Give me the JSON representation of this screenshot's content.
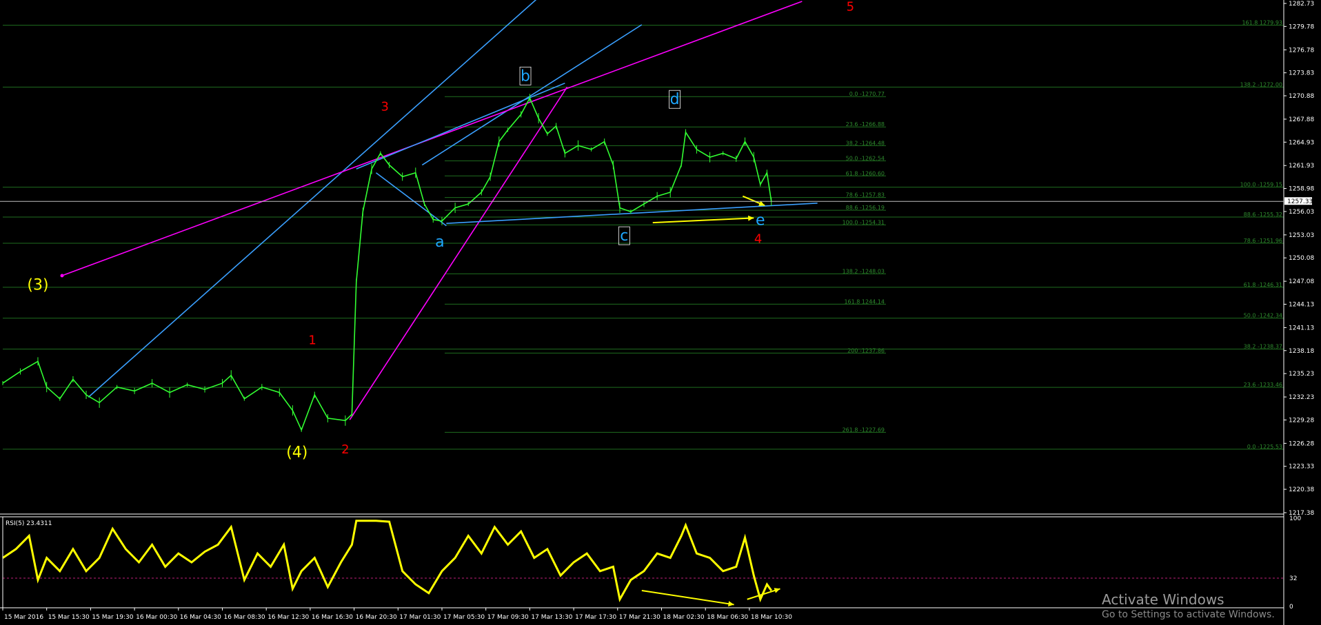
{
  "chart_data": {
    "type": "line",
    "title": "",
    "y_ticks": [
      "1282.73",
      "1279.78",
      "1276.78",
      "1273.83",
      "1270.88",
      "1267.88",
      "1264.93",
      "1261.93",
      "1258.98",
      "1256.03",
      "1253.03",
      "1250.08",
      "1247.08",
      "1244.13",
      "1241.13",
      "1238.18",
      "1235.23",
      "1232.23",
      "1229.28",
      "1226.28",
      "1223.33",
      "1220.38",
      "1217.38"
    ],
    "ylim": [
      1217.38,
      1282.73
    ],
    "x_ticks": [
      "15 Mar 2016",
      "15 Mar 15:30",
      "15 Mar 19:30",
      "16 Mar 00:30",
      "16 Mar 04:30",
      "16 Mar 08:30",
      "16 Mar 12:30",
      "16 Mar 16:30",
      "16 Mar 20:30",
      "17 Mar 01:30",
      "17 Mar 05:30",
      "17 Mar 09:30",
      "17 Mar 13:30",
      "17 Mar 17:30",
      "17 Mar 21:30",
      "18 Mar 02:30",
      "18 Mar 06:30",
      "18 Mar 10:30"
    ],
    "current_price": "1257.33",
    "price_series": [
      {
        "t": 0,
        "y": 1234.0
      },
      {
        "t": 0.4,
        "y": 1235.5
      },
      {
        "t": 0.8,
        "y": 1236.8
      },
      {
        "t": 1.0,
        "y": 1233.5
      },
      {
        "t": 1.3,
        "y": 1232.0
      },
      {
        "t": 1.6,
        "y": 1234.5
      },
      {
        "t": 1.9,
        "y": 1232.5
      },
      {
        "t": 2.2,
        "y": 1231.5
      },
      {
        "t": 2.6,
        "y": 1233.5
      },
      {
        "t": 3.0,
        "y": 1233.0
      },
      {
        "t": 3.4,
        "y": 1234.0
      },
      {
        "t": 3.8,
        "y": 1232.8
      },
      {
        "t": 4.2,
        "y": 1233.8
      },
      {
        "t": 4.6,
        "y": 1233.2
      },
      {
        "t": 5.0,
        "y": 1234.0
      },
      {
        "t": 5.2,
        "y": 1235.0
      },
      {
        "t": 5.5,
        "y": 1232.0
      },
      {
        "t": 5.9,
        "y": 1233.5
      },
      {
        "t": 6.3,
        "y": 1232.8
      },
      {
        "t": 6.6,
        "y": 1230.5
      },
      {
        "t": 6.8,
        "y": 1228.0
      },
      {
        "t": 7.1,
        "y": 1232.5
      },
      {
        "t": 7.4,
        "y": 1229.5
      },
      {
        "t": 7.8,
        "y": 1229.2
      },
      {
        "t": 7.95,
        "y": 1230.0
      },
      {
        "t": 8.05,
        "y": 1247.0
      },
      {
        "t": 8.2,
        "y": 1256.0
      },
      {
        "t": 8.4,
        "y": 1261.5
      },
      {
        "t": 8.6,
        "y": 1263.5
      },
      {
        "t": 8.8,
        "y": 1262.0
      },
      {
        "t": 9.1,
        "y": 1260.5
      },
      {
        "t": 9.4,
        "y": 1261.0
      },
      {
        "t": 9.6,
        "y": 1257.0
      },
      {
        "t": 9.8,
        "y": 1255.0
      },
      {
        "t": 10.0,
        "y": 1254.8
      },
      {
        "t": 10.3,
        "y": 1256.5
      },
      {
        "t": 10.6,
        "y": 1257.0
      },
      {
        "t": 10.9,
        "y": 1258.5
      },
      {
        "t": 11.1,
        "y": 1260.5
      },
      {
        "t": 11.3,
        "y": 1265.0
      },
      {
        "t": 11.5,
        "y": 1266.5
      },
      {
        "t": 11.8,
        "y": 1268.5
      },
      {
        "t": 12.0,
        "y": 1270.6
      },
      {
        "t": 12.2,
        "y": 1268.0
      },
      {
        "t": 12.4,
        "y": 1266.0
      },
      {
        "t": 12.6,
        "y": 1267.0
      },
      {
        "t": 12.8,
        "y": 1263.5
      },
      {
        "t": 13.1,
        "y": 1264.5
      },
      {
        "t": 13.4,
        "y": 1264.0
      },
      {
        "t": 13.7,
        "y": 1265.0
      },
      {
        "t": 13.9,
        "y": 1262.0
      },
      {
        "t": 14.05,
        "y": 1256.5
      },
      {
        "t": 14.3,
        "y": 1256.0
      },
      {
        "t": 14.6,
        "y": 1257.0
      },
      {
        "t": 14.9,
        "y": 1258.0
      },
      {
        "t": 15.2,
        "y": 1258.5
      },
      {
        "t": 15.45,
        "y": 1262.0
      },
      {
        "t": 15.55,
        "y": 1266.2
      },
      {
        "t": 15.8,
        "y": 1264.0
      },
      {
        "t": 16.1,
        "y": 1263.0
      },
      {
        "t": 16.4,
        "y": 1263.5
      },
      {
        "t": 16.7,
        "y": 1262.8
      },
      {
        "t": 16.9,
        "y": 1265.0
      },
      {
        "t": 17.1,
        "y": 1263.0
      },
      {
        "t": 17.25,
        "y": 1259.5
      },
      {
        "t": 17.4,
        "y": 1261.0
      },
      {
        "t": 17.5,
        "y": 1257.3
      }
    ],
    "rsi": {
      "label": "RSI(5) 23.4311",
      "ylim": [
        0,
        100
      ],
      "y_ticks": [
        "100",
        "32",
        "0"
      ],
      "level": 32,
      "values": [
        {
          "t": 0,
          "y": 55
        },
        {
          "t": 0.3,
          "y": 65
        },
        {
          "t": 0.6,
          "y": 80
        },
        {
          "t": 0.8,
          "y": 30
        },
        {
          "t": 1.0,
          "y": 55
        },
        {
          "t": 1.3,
          "y": 40
        },
        {
          "t": 1.6,
          "y": 65
        },
        {
          "t": 1.9,
          "y": 40
        },
        {
          "t": 2.2,
          "y": 55
        },
        {
          "t": 2.5,
          "y": 88
        },
        {
          "t": 2.8,
          "y": 65
        },
        {
          "t": 3.1,
          "y": 50
        },
        {
          "t": 3.4,
          "y": 70
        },
        {
          "t": 3.7,
          "y": 45
        },
        {
          "t": 4.0,
          "y": 60
        },
        {
          "t": 4.3,
          "y": 50
        },
        {
          "t": 4.6,
          "y": 62
        },
        {
          "t": 4.9,
          "y": 70
        },
        {
          "t": 5.2,
          "y": 90
        },
        {
          "t": 5.5,
          "y": 30
        },
        {
          "t": 5.8,
          "y": 60
        },
        {
          "t": 6.1,
          "y": 45
        },
        {
          "t": 6.4,
          "y": 70
        },
        {
          "t": 6.6,
          "y": 20
        },
        {
          "t": 6.8,
          "y": 40
        },
        {
          "t": 7.1,
          "y": 55
        },
        {
          "t": 7.4,
          "y": 22
        },
        {
          "t": 7.7,
          "y": 50
        },
        {
          "t": 7.95,
          "y": 70
        },
        {
          "t": 8.05,
          "y": 97
        },
        {
          "t": 8.5,
          "y": 97
        },
        {
          "t": 8.8,
          "y": 96
        },
        {
          "t": 9.1,
          "y": 40
        },
        {
          "t": 9.4,
          "y": 25
        },
        {
          "t": 9.7,
          "y": 15
        },
        {
          "t": 10.0,
          "y": 40
        },
        {
          "t": 10.3,
          "y": 55
        },
        {
          "t": 10.6,
          "y": 80
        },
        {
          "t": 10.9,
          "y": 60
        },
        {
          "t": 11.2,
          "y": 90
        },
        {
          "t": 11.5,
          "y": 70
        },
        {
          "t": 11.8,
          "y": 85
        },
        {
          "t": 12.1,
          "y": 55
        },
        {
          "t": 12.4,
          "y": 65
        },
        {
          "t": 12.7,
          "y": 35
        },
        {
          "t": 13.0,
          "y": 50
        },
        {
          "t": 13.3,
          "y": 60
        },
        {
          "t": 13.6,
          "y": 40
        },
        {
          "t": 13.9,
          "y": 45
        },
        {
          "t": 14.05,
          "y": 8
        },
        {
          "t": 14.3,
          "y": 30
        },
        {
          "t": 14.6,
          "y": 40
        },
        {
          "t": 14.9,
          "y": 60
        },
        {
          "t": 15.2,
          "y": 55
        },
        {
          "t": 15.45,
          "y": 80
        },
        {
          "t": 15.55,
          "y": 92
        },
        {
          "t": 15.8,
          "y": 60
        },
        {
          "t": 16.1,
          "y": 55
        },
        {
          "t": 16.4,
          "y": 40
        },
        {
          "t": 16.7,
          "y": 45
        },
        {
          "t": 16.9,
          "y": 78
        },
        {
          "t": 17.1,
          "y": 35
        },
        {
          "t": 17.25,
          "y": 8
        },
        {
          "t": 17.4,
          "y": 25
        },
        {
          "t": 17.5,
          "y": 18
        }
      ]
    },
    "fib_left": [
      {
        "label": "0.0 -1270.77",
        "y": 1270.77
      },
      {
        "label": "23.6 -1266.88",
        "y": 1266.88
      },
      {
        "label": "38.2 -1264.48",
        "y": 1264.48
      },
      {
        "label": "50.0 -1262.54",
        "y": 1262.54
      },
      {
        "label": "61.8 -1260.60",
        "y": 1260.6
      },
      {
        "label": "78.6 -1257.83",
        "y": 1257.83
      },
      {
        "label": "88.6 -1256.19",
        "y": 1256.19
      },
      {
        "label": "100.0 -1254.31",
        "y": 1254.31
      },
      {
        "label": "138.2 -1248.03",
        "y": 1248.03
      },
      {
        "label": "161.8 1244.14",
        "y": 1244.14
      },
      {
        "label": "200 -1237.86",
        "y": 1237.86
      },
      {
        "label": "261.8 -1227.69",
        "y": 1227.69
      }
    ],
    "fib_right": [
      {
        "label": "161.8 1279.93",
        "y": 1279.93
      },
      {
        "label": "138.2 -1272.00",
        "y": 1272.0
      },
      {
        "label": "100.0 -1259.15",
        "y": 1259.15
      },
      {
        "label": "88.6 -1255.32",
        "y": 1255.32
      },
      {
        "label": "78.6 -1251.96",
        "y": 1251.96
      },
      {
        "label": "61.8 -1246.31",
        "y": 1246.31
      },
      {
        "label": "50.0 -1242.34",
        "y": 1242.34
      },
      {
        "label": "38.2 -1238.37",
        "y": 1238.37
      },
      {
        "label": "23.6 -1233.46",
        "y": 1233.46
      },
      {
        "label": "0.0 -1225.53",
        "y": 1225.53
      }
    ],
    "wave_labels": [
      {
        "text": "(3)",
        "t": 0.8,
        "y": 1246.0,
        "color": "#ffff00",
        "size": 22
      },
      {
        "text": "(4)",
        "t": 6.7,
        "y": 1224.5,
        "color": "#ffff00",
        "size": 22
      },
      {
        "text": "1",
        "t": 7.05,
        "y": 1239.0,
        "color": "#ff0000",
        "size": 18
      },
      {
        "text": "2",
        "t": 7.8,
        "y": 1225.0,
        "color": "#ff0000",
        "size": 18
      },
      {
        "text": "3",
        "t": 8.7,
        "y": 1269.0,
        "color": "#ff0000",
        "size": 18
      },
      {
        "text": "4",
        "t": 17.2,
        "y": 1252.0,
        "color": "#ff0000",
        "size": 18
      },
      {
        "text": "5",
        "t": 19.3,
        "y": 1281.8,
        "color": "#ff0000",
        "size": 18
      },
      {
        "text": "a",
        "t": 9.95,
        "y": 1251.5,
        "color": "#1ea7ff",
        "size": 22
      },
      {
        "text": "b",
        "t": 11.9,
        "y": 1272.8,
        "color": "#1ea7ff",
        "size": 22
      },
      {
        "text": "c",
        "t": 14.15,
        "y": 1252.3,
        "color": "#1ea7ff",
        "size": 22
      },
      {
        "text": "d",
        "t": 15.3,
        "y": 1269.8,
        "color": "#1ea7ff",
        "size": 22
      },
      {
        "text": "e",
        "t": 17.25,
        "y": 1254.3,
        "color": "#1ea7ff",
        "size": 22
      }
    ],
    "trendlines": [
      {
        "color": "#3aa0ff",
        "p1": {
          "t": 1.95,
          "y": 1232.2
        },
        "p2": {
          "t": 12.5,
          "y": 1285.0
        }
      },
      {
        "color": "#3aa0ff",
        "p1": {
          "t": 9.55,
          "y": 1262.0
        },
        "p2": {
          "t": 14.55,
          "y": 1280.0
        }
      },
      {
        "color": "#ff00ff",
        "p1": {
          "t": 1.35,
          "y": 1247.8
        },
        "p2": {
          "t": 18.2,
          "y": 1283.0
        }
      },
      {
        "color": "#ff00ff",
        "p1": {
          "t": 7.9,
          "y": 1229.3
        },
        "p2": {
          "t": 12.85,
          "y": 1272.0
        }
      },
      {
        "color": "#3aa0ff",
        "p1": {
          "t": 10.1,
          "y": 1254.5
        },
        "p2": {
          "t": 18.55,
          "y": 1257.1
        }
      },
      {
        "color": "#3aa0ff",
        "p1": {
          "t": 8.5,
          "y": 1261.0
        },
        "p2": {
          "t": 10.1,
          "y": 1254.2
        }
      },
      {
        "color": "#3aa0ff",
        "p1": {
          "t": 8.05,
          "y": 1261.5
        },
        "p2": {
          "t": 12.8,
          "y": 1272.5
        }
      }
    ],
    "arrows": [
      {
        "color": "#ffff00",
        "p1": {
          "t": 14.8,
          "y": 1254.6
        },
        "p2": {
          "t": 17.1,
          "y": 1255.2
        }
      },
      {
        "color": "#ffff00",
        "p1": {
          "t": 16.85,
          "y": 1258.0
        },
        "p2": {
          "t": 17.35,
          "y": 1256.8
        }
      }
    ],
    "rsi_arrows": [
      {
        "color": "#ffff00",
        "p1": {
          "t": 14.55,
          "y": 18
        },
        "p2": {
          "t": 16.65,
          "y": 2
        }
      },
      {
        "color": "#ffff00",
        "p1": {
          "t": 16.95,
          "y": 8
        },
        "p2": {
          "t": 17.7,
          "y": 20
        }
      }
    ]
  },
  "watermark": {
    "line1": "Activate Windows",
    "line2": "Go to Settings to activate Windows."
  }
}
